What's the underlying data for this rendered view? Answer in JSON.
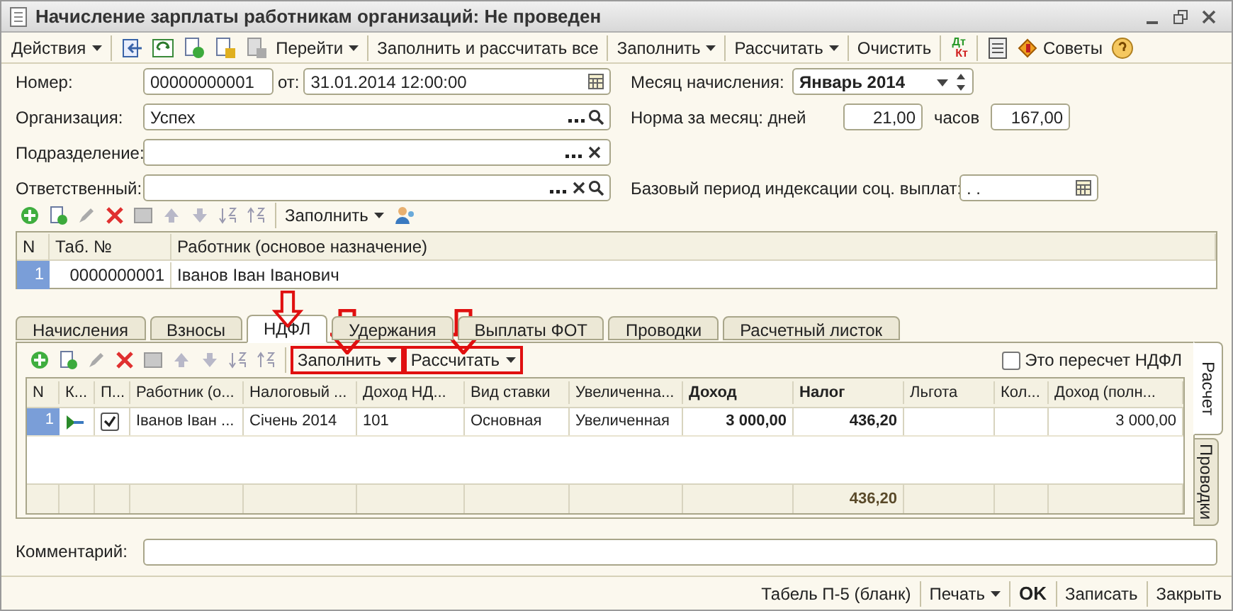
{
  "window": {
    "title": "Начисление зарплаты работникам организаций: Не проведен"
  },
  "toolbar": [
    {
      "label": "Действия",
      "kind": "menu"
    },
    {
      "kind": "icon"
    },
    {
      "kind": "icon"
    },
    {
      "kind": "icon"
    },
    {
      "kind": "icon"
    },
    {
      "kind": "icon"
    },
    {
      "label": "Перейти",
      "kind": "menu"
    },
    {
      "label": "Заполнить и рассчитать все",
      "kind": "text"
    },
    {
      "label": "Заполнить",
      "kind": "menu"
    },
    {
      "label": "Рассчитать",
      "kind": "menu"
    },
    {
      "label": "Очистить",
      "kind": "text"
    },
    {
      "label": "Дт",
      "label2": "Кт",
      "kind": "dtkt"
    },
    {
      "kind": "icon"
    },
    {
      "label": "Советы",
      "kind": "tips"
    },
    {
      "kind": "icon"
    }
  ],
  "form": {
    "number_label": "Номер:",
    "number": "00000000001",
    "date_label": "от:",
    "date": "31.01.2014 12:00:00",
    "org_label": "Организация:",
    "org": "Успех",
    "dept_label": "Подразделение:",
    "resp_label": "Ответственный:",
    "month_label": "Месяц начисления:",
    "month": "Январь 2014",
    "norm_label": "Норма за месяц: дней",
    "days": "21,00",
    "hours_label": "часов",
    "hours": "167,00",
    "base_label": "Базовый период индексации соц. выплат:",
    "base": ". ."
  },
  "employees": {
    "fill_label": "Заполнить",
    "columns": [
      "N",
      "Таб. №",
      "Работник (основое назначение)"
    ],
    "rows": [
      {
        "n": "1",
        "tab": "0000000001",
        "name": "Іванов Іван Іванович",
        "selected": true
      }
    ]
  },
  "tabs": [
    {
      "label": "Начисления",
      "selected": false,
      "arrow": false
    },
    {
      "label": "Взносы",
      "selected": false,
      "arrow": false
    },
    {
      "label": "НДФЛ",
      "selected": true,
      "arrow": true
    },
    {
      "label": "Удержания",
      "selected": false,
      "arrow": false
    },
    {
      "label": "Выплаты ФОТ",
      "selected": false,
      "arrow": false
    },
    {
      "label": "Проводки",
      "selected": false,
      "arrow": false
    },
    {
      "label": "Расчетный листок",
      "selected": false,
      "arrow": false
    }
  ],
  "ndfl": {
    "buttons": [
      {
        "label": "Заполнить",
        "highlighted": true,
        "arrow": true
      },
      {
        "label": "Рассчитать",
        "highlighted": true,
        "arrow": true
      }
    ],
    "recalc": {
      "label": "Это пересчет НДФЛ",
      "checked": false
    },
    "columns": [
      {
        "label": "N",
        "bold": false
      },
      {
        "label": "К...",
        "bold": false
      },
      {
        "label": "П...",
        "bold": false
      },
      {
        "label": "Работник (о...",
        "bold": false
      },
      {
        "label": "Налоговый ...",
        "bold": false
      },
      {
        "label": "Доход НД...",
        "bold": false
      },
      {
        "label": "Вид ставки",
        "bold": false
      },
      {
        "label": "Увеличенна...",
        "bold": false
      },
      {
        "label": "Доход",
        "bold": true
      },
      {
        "label": "Налог",
        "bold": true
      },
      {
        "label": "Льгота",
        "bold": false
      },
      {
        "label": "Кол...",
        "bold": false
      },
      {
        "label": "Доход (полн...",
        "bold": false
      }
    ],
    "rows": [
      {
        "checked": true,
        "selected": true,
        "cells": [
          "1",
          "",
          "",
          "Іванов Іван ...",
          "Січень 2014",
          "101",
          "Основная",
          "Увеличенная",
          "3 000,00",
          "436,20",
          "",
          "",
          "3 000,00"
        ]
      }
    ],
    "total_tax": "436,20",
    "side_tabs": [
      {
        "label": "Расчет",
        "selected": true
      },
      {
        "label": "Проводки",
        "selected": false
      }
    ]
  },
  "comment_label": "Комментарий:",
  "footer": [
    {
      "label": "Табель П-5 (бланк)",
      "kind": "text"
    },
    {
      "label": "Печать",
      "kind": "menu"
    },
    {
      "label": "OK",
      "kind": "bold"
    },
    {
      "label": "Записать",
      "kind": "text"
    },
    {
      "label": "Закрыть",
      "kind": "text"
    }
  ]
}
